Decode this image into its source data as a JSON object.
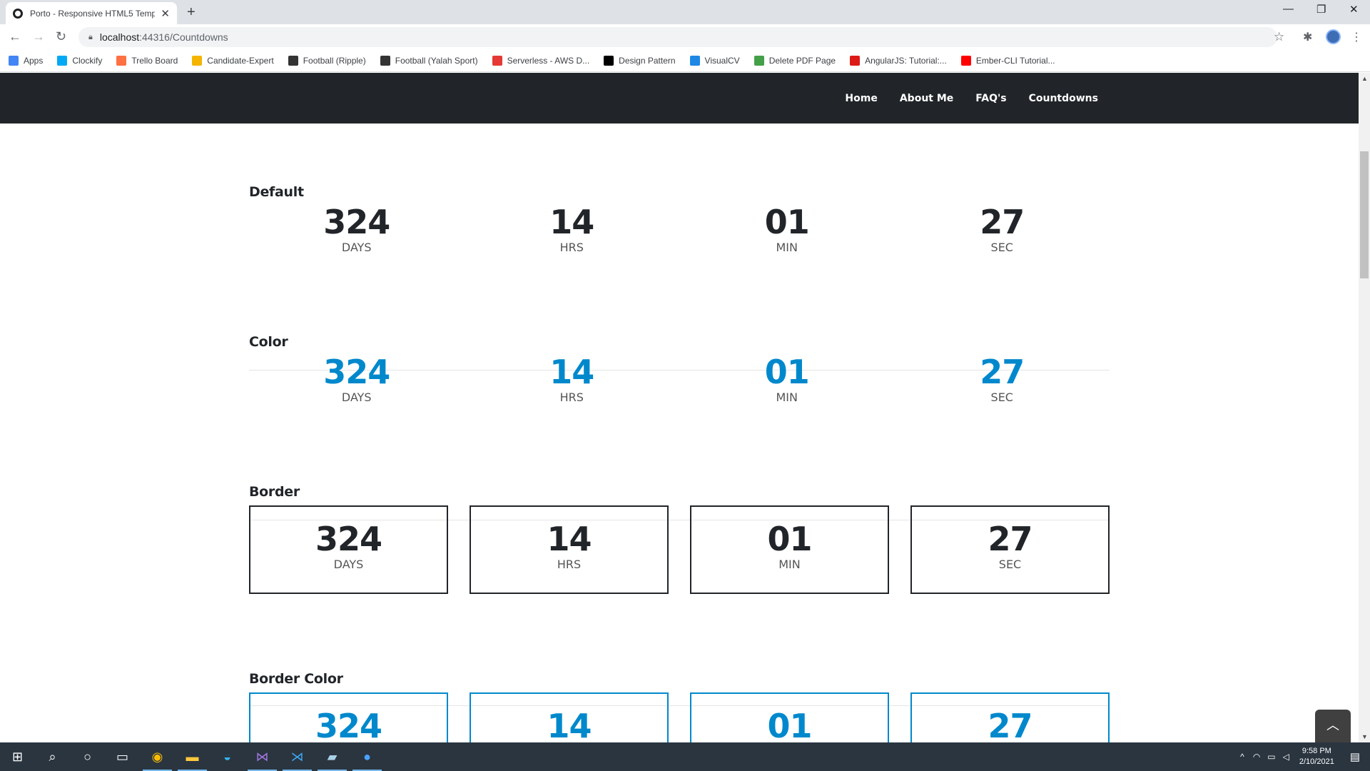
{
  "browser": {
    "tab_title": "Porto - Responsive HTML5 Temp",
    "url_host": "localhost",
    "url_path": ":44316/Countdowns",
    "bookmarks": [
      {
        "label": "Apps",
        "color": "#4285f4"
      },
      {
        "label": "Clockify",
        "color": "#03a9f4"
      },
      {
        "label": "Trello Board",
        "color": "#ff7043"
      },
      {
        "label": "Candidate-Expert",
        "color": "#f4b400"
      },
      {
        "label": "Football (Ripple)",
        "color": "#333333"
      },
      {
        "label": "Football (Yalah Sport)",
        "color": "#333333"
      },
      {
        "label": "Serverless - AWS D...",
        "color": "#e53935"
      },
      {
        "label": "Design Pattern",
        "color": "#000000"
      },
      {
        "label": "VisualCV",
        "color": "#1e88e5"
      },
      {
        "label": "Delete PDF Page",
        "color": "#43a047"
      },
      {
        "label": "AngularJS: Tutorial:...",
        "color": "#dd1b16"
      },
      {
        "label": "Ember-CLI Tutorial...",
        "color": "#ff0000"
      }
    ]
  },
  "nav": {
    "items": [
      "Home",
      "About Me",
      "FAQ's",
      "Countdowns"
    ]
  },
  "sections": [
    {
      "title": "Default"
    },
    {
      "title": "Color"
    },
    {
      "title": "Border"
    },
    {
      "title": "Border Color"
    }
  ],
  "countdown": [
    {
      "value": "324",
      "unit": "DAYS"
    },
    {
      "value": "14",
      "unit": "HRS"
    },
    {
      "value": "01",
      "unit": "MIN"
    },
    {
      "value": "27",
      "unit": "SEC"
    }
  ],
  "accent_color": "#0088cc",
  "taskbar": {
    "time": "9:58 PM",
    "date": "2/10/2021"
  }
}
